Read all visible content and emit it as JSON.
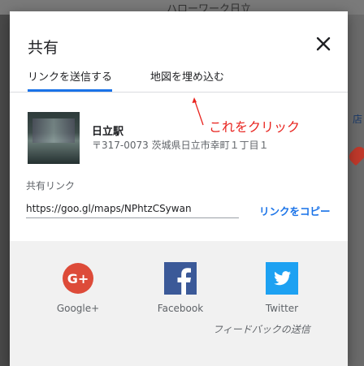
{
  "background": {
    "top_label": "ハローワーク日立",
    "right_text": "店"
  },
  "dialog": {
    "title": "共有",
    "tabs": [
      {
        "label": "リンクを送信する",
        "active": true
      },
      {
        "label": "地図を埋め込む",
        "active": false
      }
    ],
    "place": {
      "name": "日立駅",
      "address": "〒317-0073 茨城県日立市幸町１丁目１"
    },
    "share_link_label": "共有リンク",
    "share_link_value": "https://goo.gl/maps/NPhtzCSywan",
    "copy_link_label": "リンクをコピー",
    "social": [
      {
        "name": "Google+",
        "icon": "google-plus-icon",
        "color": "#dd4b39"
      },
      {
        "name": "Facebook",
        "icon": "facebook-icon",
        "color": "#3b5998"
      },
      {
        "name": "Twitter",
        "icon": "twitter-icon",
        "color": "#1da1f2"
      }
    ],
    "feedback_label": "フィードバックの送信"
  },
  "annotation": {
    "text": "これをクリック",
    "color": "#e8231e"
  },
  "colors": {
    "accent": "#1a73e8"
  }
}
